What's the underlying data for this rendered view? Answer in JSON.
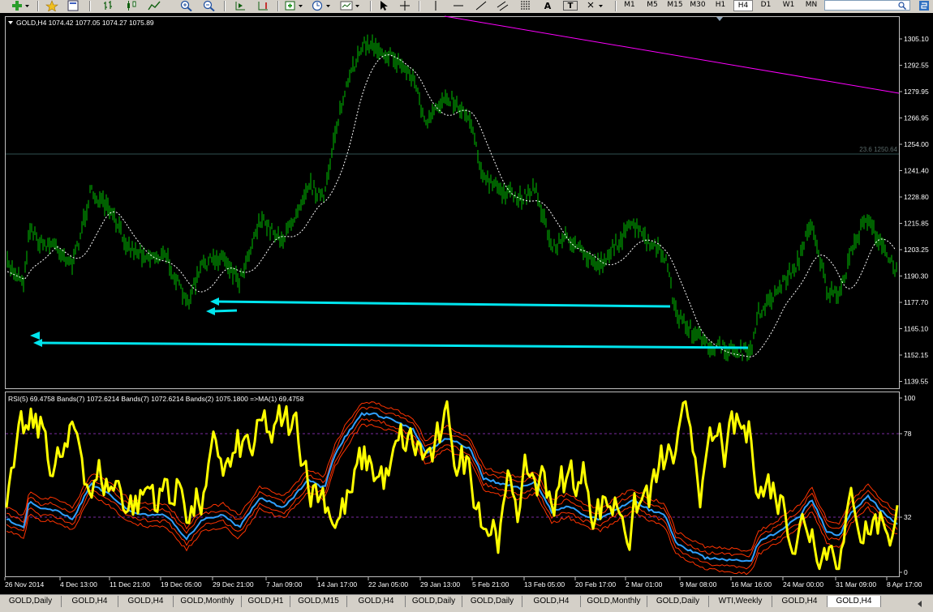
{
  "toolbar": {
    "timeframes": [
      "M1",
      "M5",
      "M15",
      "M30",
      "H1",
      "H4",
      "D1",
      "W1",
      "MN"
    ],
    "active_timeframe": "H4",
    "drawing_tools": {
      "text_label": "A",
      "text_box_label": "T"
    }
  },
  "main_chart": {
    "header": "GOLD,H4  1074.42 1077.05 1074.27 1075.89",
    "fib_label": "23.6 1250.64",
    "price_ticks": [
      "1305.10",
      "1292.55",
      "1279.95",
      "1266.95",
      "1254.00",
      "1241.40",
      "1228.80",
      "1215.85",
      "1203.25",
      "1190.30",
      "1177.70",
      "1165.10",
      "1152.15",
      "1139.55"
    ],
    "colors": {
      "candles": "#00c000",
      "ma": "#ffffff",
      "arrows": "#00e5ee",
      "trendline": "#ff00ff",
      "fib": "#2f4f4f"
    }
  },
  "rsi_panel": {
    "header": "RSI(5) 69.4758  Bands(7) 1072.6214  Bands(7) 1072.6214  Bands(2) 1075.1800  =>MA(1) 69.4758",
    "levels": [
      "100",
      "78",
      "32",
      "0"
    ],
    "colors": {
      "rsi": "#ffff00",
      "ma": "#2fa0ff",
      "bands": "#ff3300"
    }
  },
  "time_axis": [
    "26 Nov 2014",
    "4 Dec 13:00",
    "11 Dec 21:00",
    "19 Dec 05:00",
    "29 Dec 21:00",
    "7 Jan 09:00",
    "14 Jan 17:00",
    "22 Jan 05:00",
    "29 Jan 13:00",
    "5 Feb 21:00",
    "13 Feb 05:00",
    "20 Feb 17:00",
    "2 Mar 01:00",
    "9 Mar 08:00",
    "16 Mar 16:00",
    "24 Mar 00:00",
    "31 Mar 09:00",
    "8 Apr 17:00"
  ],
  "tabs": [
    "GOLD,Daily",
    "GOLD,H4",
    "GOLD,H4",
    "GOLD,Monthly",
    "GOLD,H1",
    "GOLD,M15",
    "GOLD,H4",
    "GOLD,Daily",
    "GOLD,Daily",
    "GOLD,H4",
    "GOLD,Monthly",
    "GOLD,Daily",
    "WTI,Weekly",
    "GOLD,H4",
    "GOLD,H4"
  ],
  "active_tab": 14
}
